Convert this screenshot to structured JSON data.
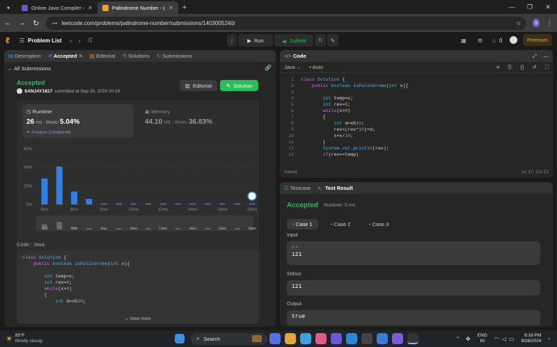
{
  "browser": {
    "tabs": [
      {
        "title": "Online Java Compiler - Program",
        "active": false
      },
      {
        "title": "Palindrome Number - LeetCode",
        "active": true
      }
    ],
    "url": "leetcode.com/problems/palindrome-number/submissions/1403005240/",
    "profile_initial": "S"
  },
  "lc_nav": {
    "problem_list": "Problem List",
    "run": "Run",
    "submit": "Submit",
    "streak": "0",
    "premium": "Premium"
  },
  "left_tabs": [
    "Description",
    "Accepted",
    "Editorial",
    "Solutions",
    "Submissions"
  ],
  "all_submissions": "All Submissions",
  "result": {
    "status": "Accepted",
    "user": "SANJAY1817",
    "submitted": "submitted at Sep 26, 2024 20:18",
    "editorial_btn": "Editorial",
    "solution_btn": "Solution"
  },
  "runtime": {
    "label": "Runtime",
    "value": "26",
    "unit": "ms",
    "beats_label": "Beats",
    "beats": "5.04%",
    "analyze": "Analyze Complexity"
  },
  "memory": {
    "label": "Memory",
    "value": "44.10",
    "unit": "MB",
    "beats_label": "Beats",
    "beats": "36.83%"
  },
  "chart_data": {
    "type": "bar",
    "categories": [
      "4ms",
      "5ms",
      "6ms",
      "7ms",
      "8ms",
      "9ms",
      "10ms",
      "11ms",
      "12ms",
      "13ms",
      "14ms",
      "15ms",
      "16ms",
      "17ms",
      "18ms"
    ],
    "tick_labels": [
      "4ms",
      "6ms",
      "8ms",
      "10ms",
      "12ms",
      "14ms",
      "16ms",
      "18ms"
    ],
    "values": [
      28,
      41,
      14,
      6,
      1,
      1,
      1,
      1,
      1,
      1,
      1,
      1,
      1,
      1,
      1
    ],
    "y_ticks": [
      "60%",
      "40%",
      "20%",
      "0%"
    ],
    "ylim": [
      0,
      60
    ],
    "bar_color": "#2f7fe8",
    "mini_labels": [
      "4ms",
      "6ms",
      "8ms",
      "10ms",
      "12ms",
      "14ms",
      "16ms",
      "18ms"
    ]
  },
  "code_preview": {
    "header": "Code",
    "lang": "Java",
    "lines": [
      "class Solution {",
      "    public boolean isPalindrome(int x){",
      "",
      "        int temp=x;",
      "        int rev=0;",
      "        while(x>0)",
      "        {",
      "            int d=x%10;"
    ],
    "view_more": "View more"
  },
  "editor": {
    "title": "Code",
    "lang": "Java",
    "mode": "Auto",
    "lines": [
      "class Solution {",
      "    public boolean isPalindrome(int x){",
      "",
      "        int temp=x;",
      "        int rev=0;",
      "        while(x>0)",
      "        {",
      "            int d=x%10;",
      "            rev=(rev*10)+d;",
      "            x=x/10;",
      "        }",
      "        System.out.println(rev);",
      "        if(rev==temp)"
    ],
    "saved": "Saved",
    "position": "Ln 17, Col 21"
  },
  "testpanel": {
    "tabs": [
      "Testcase",
      "Test Result"
    ],
    "status": "Accepted",
    "runtime": "Runtime: 0 ms",
    "cases": [
      "Case 1",
      "Case 2",
      "Case 3"
    ],
    "input_label": "Input",
    "input_var": "x =",
    "input_val": "121",
    "stdout_label": "Stdout",
    "stdout_val": "121",
    "output_label": "Output",
    "output_val": "true"
  },
  "taskbar": {
    "temp": "85°F",
    "weather": "Mostly cloudy",
    "search": "Search",
    "lang1": "ENG",
    "lang2": "IN",
    "time": "8:18 PM",
    "date": "9/26/2024"
  },
  "colors": {
    "accent_green": "#2cbb5d",
    "accent_blue": "#2f7fe8",
    "success_text": "#2cbb5d"
  }
}
